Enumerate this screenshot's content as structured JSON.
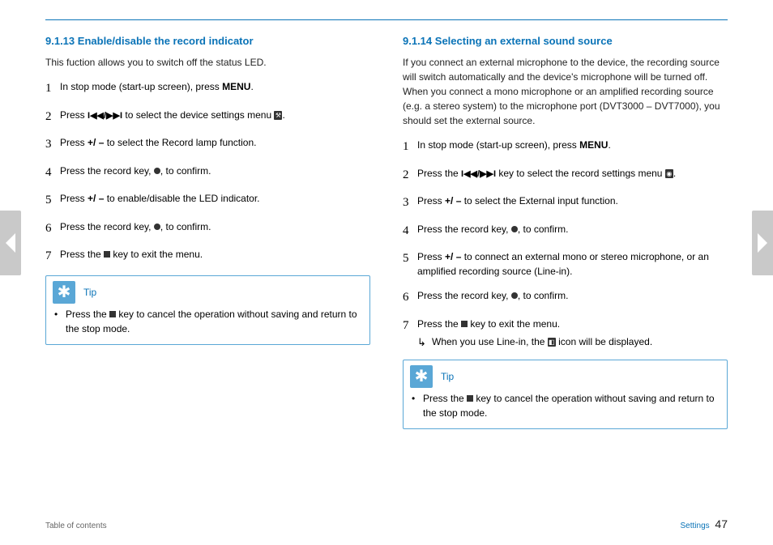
{
  "left": {
    "heading_num": "9.1.13",
    "heading_title": "Enable/disable the record indicator",
    "intro": "This fuction allows you to switch off the status LED.",
    "steps": [
      {
        "pre": "In stop mode (start-up screen), press ",
        "bold": "MENU",
        "post": "."
      },
      {
        "pre": "Press ",
        "icon": "seek",
        "post1": " to select the device settings menu ",
        "chip": "⚒",
        "post2": "."
      },
      {
        "pre": "Press ",
        "bold": "+/ –",
        "post": " to select the ",
        "alt": "Record lamp",
        "post2": " function."
      },
      {
        "pre": "Press the record key, ",
        "icon": "dot",
        "post": ", to confirm."
      },
      {
        "pre": "Press ",
        "bold": "+/ –",
        "post": " to enable/disable the LED indicator."
      },
      {
        "pre": "Press the record key, ",
        "icon": "dot",
        "post": ", to confirm."
      },
      {
        "pre": "Press the ",
        "icon": "stop",
        "post": " key to exit the menu."
      }
    ],
    "tip_label": "Tip",
    "tip_pre": "Press the ",
    "tip_post": " key to cancel the operation without saving and return to the stop mode."
  },
  "right": {
    "heading_num": "9.1.14",
    "heading_title": "Selecting an external sound source",
    "intro": "If you connect an external microphone to the device, the recording source will switch automatically and the device's microphone will be turned off. When you connect a mono microphone or an amplified recording source (e.g. a stereo system) to the microphone port (DVT3000 – DVT7000), you should set the external source.",
    "steps": [
      {
        "pre": "In stop mode (start-up screen), press ",
        "bold": "MENU",
        "post": "."
      },
      {
        "pre": "Press the ",
        "icon": "seek",
        "post1": " key to select the record settings menu ",
        "chip": "◉",
        "post2": "."
      },
      {
        "pre": "Press ",
        "bold": "+/ –",
        "post": " to select the ",
        "alt": "External input",
        "post2": " function."
      },
      {
        "pre": "Press the record key, ",
        "icon": "dot",
        "post": ", to confirm."
      },
      {
        "pre": "Press ",
        "bold": "+/ –",
        "post": " to connect an external mono or stereo microphone, or an amplified recording source (",
        "alt": "Line-in",
        "post2": ")."
      },
      {
        "pre": "Press the record key, ",
        "icon": "dot",
        "post": ", to confirm."
      },
      {
        "pre": "Press the ",
        "icon": "stop",
        "post": " key to exit the menu.",
        "sub_pre": "When you use ",
        "sub_alt": "Line-in",
        "sub_mid": ", the ",
        "sub_chip": "◧",
        "sub_post": " icon will be displayed."
      }
    ],
    "tip_label": "Tip",
    "tip_pre": "Press the ",
    "tip_post": " key to cancel the operation without saving and return to the stop mode."
  },
  "footer": {
    "left": "Table of contents",
    "right_label": "Settings",
    "page": "47"
  }
}
